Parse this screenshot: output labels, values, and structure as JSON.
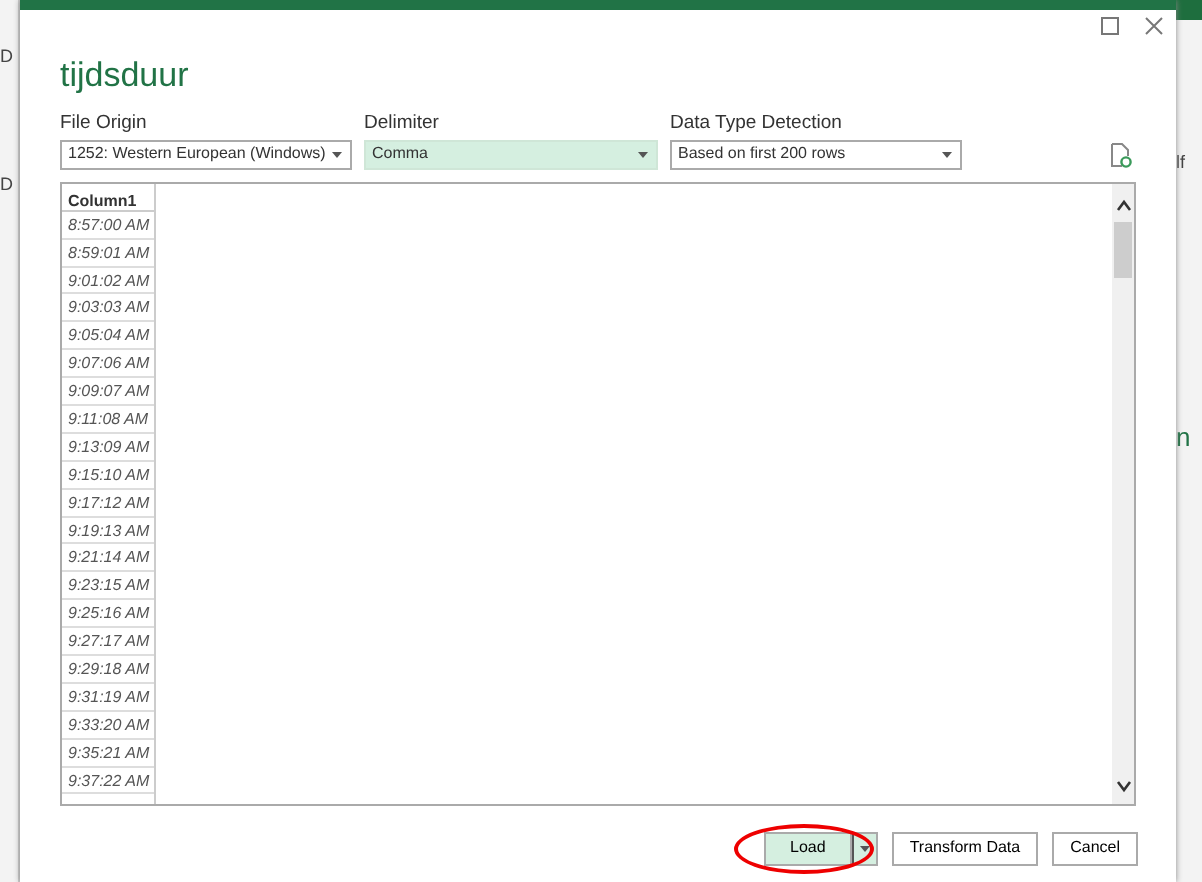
{
  "background_app": {
    "left_fragments": [
      "D",
      "D"
    ],
    "right_fragments": [
      "lf",
      "n"
    ]
  },
  "dialog": {
    "title": "tijdsduur",
    "options": [
      {
        "label": "File Origin",
        "value": "1252: Western European (Windows)",
        "selected": false
      },
      {
        "label": "Delimiter",
        "value": "Comma",
        "selected": true
      },
      {
        "label": "Data Type Detection",
        "value": "Based on first 200 rows",
        "selected": false
      }
    ],
    "preview": {
      "columns": [
        "Column1"
      ],
      "rows": [
        "8:57:00 AM",
        "8:59:01 AM",
        "9:01:02 AM",
        "9:03:03 AM",
        "9:05:04 AM",
        "9:07:06 AM",
        "9:09:07 AM",
        "9:11:08 AM",
        "9:13:09 AM",
        "9:15:10 AM",
        "9:17:12 AM",
        "9:19:13 AM",
        "9:21:14 AM",
        "9:23:15 AM",
        "9:25:16 AM",
        "9:27:17 AM",
        "9:29:18 AM",
        "9:31:19 AM",
        "9:33:20 AM",
        "9:35:21 AM",
        "9:37:22 AM"
      ]
    },
    "buttons": [
      {
        "label": "Load",
        "kind": "split",
        "highlighted": true
      },
      {
        "label": "Transform Data",
        "kind": "plain",
        "highlighted": false
      },
      {
        "label": "Cancel",
        "kind": "plain",
        "highlighted": false
      }
    ]
  }
}
